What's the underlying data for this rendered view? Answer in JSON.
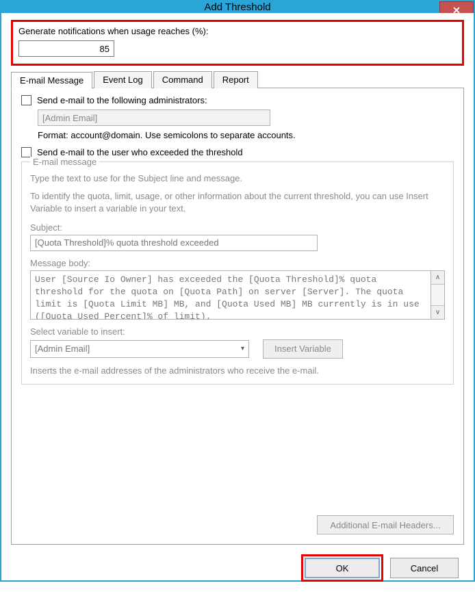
{
  "window": {
    "title": "Add Threshold",
    "close_glyph": "✕"
  },
  "threshold": {
    "label": "Generate notifications when usage reaches (%):",
    "value": "85"
  },
  "tabs": {
    "email": "E-mail Message",
    "eventlog": "Event Log",
    "command": "Command",
    "report": "Report"
  },
  "email": {
    "send_admins_label": "Send e-mail to the following administrators:",
    "admin_email_placeholder": "[Admin Email]",
    "format_hint": "Format: account@domain. Use semicolons to separate accounts.",
    "send_user_label": "Send e-mail to the user who exceeded the threshold",
    "fieldset_legend": "E-mail message",
    "type_hint": "Type the text to use for the Subject line and message.",
    "identify_hint": "To identify the quota, limit, usage, or other information about the current threshold, you can use Insert Variable to insert a variable in your text.",
    "subject_label": "Subject:",
    "subject_value": "[Quota Threshold]% quota threshold exceeded",
    "body_label": "Message body:",
    "body_value": "User [Source Io Owner] has exceeded the [Quota Threshold]% quota threshold for the quota on [Quota Path] on server [Server]. The quota limit is [Quota Limit MB] MB, and [Quota Used MB] MB currently is in use ([Quota Used Percent]% of limit).",
    "select_var_label": "Select variable to insert:",
    "select_var_value": "[Admin Email]",
    "insert_var_btn": "Insert Variable",
    "insert_desc": "Inserts the e-mail addresses of the administrators who receive the e-mail.",
    "addl_headers_btn": "Additional E-mail Headers..."
  },
  "footer": {
    "ok": "OK",
    "cancel": "Cancel"
  }
}
